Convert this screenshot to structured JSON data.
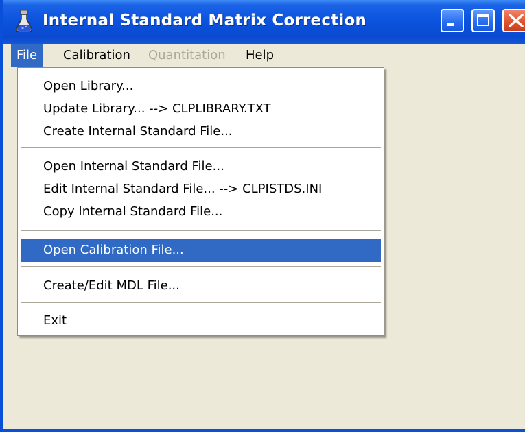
{
  "window": {
    "title": "Internal Standard Matrix Correction",
    "icon": "flask-icon",
    "controls": [
      "minimize-icon",
      "maximize-icon",
      "close-icon"
    ]
  },
  "colors": {
    "titlebar": "#0b52dd",
    "highlight": "#316ac5",
    "window_bg": "#ece9d8",
    "disabled_text": "#aca899",
    "close_button": "#e0542c"
  },
  "menubar": {
    "file": "File",
    "calibration": "Calibration",
    "quantitation": "Quantitation",
    "help": "Help"
  },
  "file_menu": {
    "open_library": "Open Library...",
    "update_library": "Update Library...  --> CLPLIBRARY.TXT",
    "create_istd": "Create Internal Standard File...",
    "open_istd": "Open Internal Standard File...",
    "edit_istd": "Edit Internal Standard File...  --> CLPISTDS.INI",
    "copy_istd": "Copy Internal Standard File...",
    "open_calibration": "Open Calibration File...",
    "create_mdl": "Create/Edit MDL File...",
    "exit": "Exit"
  }
}
